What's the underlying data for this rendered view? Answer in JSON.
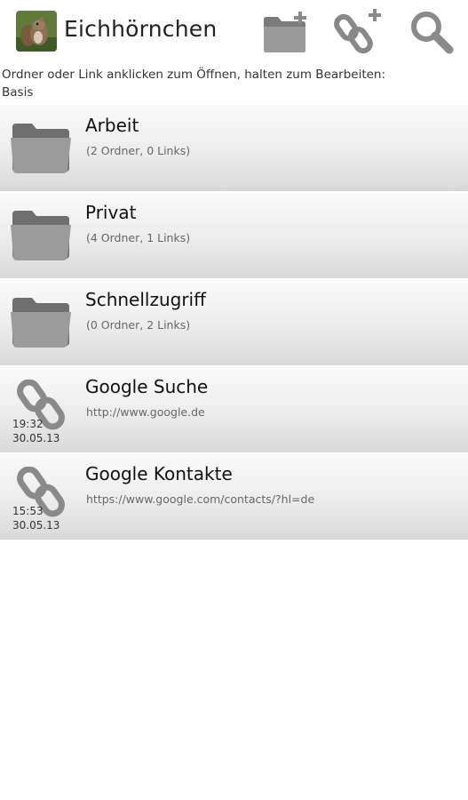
{
  "app": {
    "title": "Eichhörnchen",
    "logo_icon": "squirrel-photo-icon"
  },
  "toolbar": {
    "buttons": [
      {
        "icon": "folder-add-icon"
      },
      {
        "icon": "link-add-icon"
      },
      {
        "icon": "search-icon"
      }
    ]
  },
  "hint": {
    "text": "Ordner oder Link anklicken zum Öffnen, halten zum Bearbeiten:",
    "path": "Basis"
  },
  "items": [
    {
      "type": "folder",
      "icon": "folder-icon",
      "title": "Arbeit",
      "subtitle": "(2 Ordner, 0 Links)"
    },
    {
      "type": "folder",
      "icon": "folder-icon",
      "title": "Privat",
      "subtitle": "(4 Ordner, 1 Links)"
    },
    {
      "type": "folder",
      "icon": "folder-icon",
      "title": "Schnellzugriff",
      "subtitle": "(0 Ordner, 2 Links)"
    },
    {
      "type": "link",
      "icon": "link-chain-icon",
      "title": "Google Suche",
      "subtitle": "http://www.google.de",
      "time": "19:32",
      "date": "30.05.13"
    },
    {
      "type": "link",
      "icon": "link-chain-icon",
      "title": "Google Kontakte",
      "subtitle": "https://www.google.com/contacts/?hl=de",
      "time": "15:53",
      "date": "30.05.13"
    }
  ],
  "colors": {
    "icon_gray": "#8a8a8a",
    "icon_dark": "#6e6e6e",
    "row_top": "#fafafa",
    "row_bottom": "#d9d9d9"
  }
}
